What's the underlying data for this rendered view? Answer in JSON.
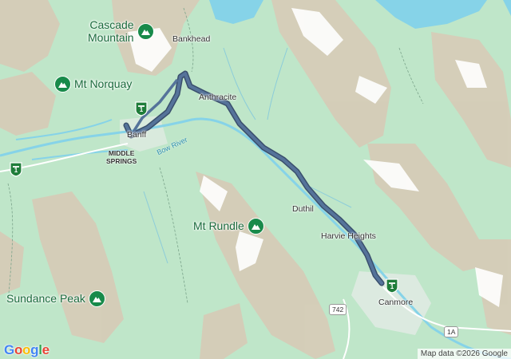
{
  "map": {
    "colors": {
      "land": "#bfe6c9",
      "water": "#86d3e8",
      "route": "#4e6a8f",
      "route_outline": "#3a4f6d",
      "peak_pin": "#188a4a",
      "peak_text": "#1b6b3d"
    },
    "peaks": [
      {
        "line1": "Cascade",
        "line2": "Mountain",
        "icon": "mountain-icon"
      },
      {
        "line1": "Mt Norquay",
        "icon": "mountain-icon"
      },
      {
        "line1": "Mt Rundle",
        "icon": "mountain-icon"
      },
      {
        "line1": "Sundance Peak",
        "icon": "mountain-icon"
      }
    ],
    "places": {
      "bankhead": "Bankhead",
      "anthracite": "Anthracite",
      "banff": "Banff",
      "middle_springs_1": "MIDDLE",
      "middle_springs_2": "SPRINGS",
      "duthil": "Duthil",
      "harvie_heights": "Harvie Heights",
      "canmore": "Canmore"
    },
    "river": "Bow River",
    "highway_shields": [
      "1",
      "1",
      "1"
    ],
    "route_shields": [
      "742",
      "1A"
    ],
    "google_logo": {
      "letters": [
        "G",
        "o",
        "o",
        "g",
        "l",
        "e"
      ],
      "colors": [
        "#4285F4",
        "#EA4335",
        "#FBBC05",
        "#4285F4",
        "#34A853",
        "#EA4335"
      ]
    },
    "attribution": "Map data ©2026 Google"
  }
}
